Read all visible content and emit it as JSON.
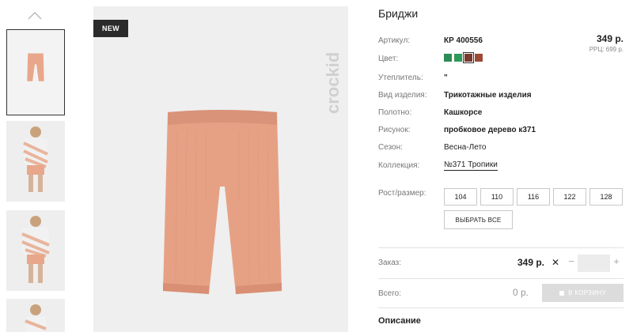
{
  "gallery": {
    "up_icon": "chevron-up-icon",
    "badge": "NEW",
    "brand_logo": "crockid"
  },
  "product": {
    "title": "Бриджи",
    "price": "349 р.",
    "rrp": "РРЦ: 699 р.",
    "rows": [
      {
        "label": "Артикул:",
        "value": "КР 400556"
      },
      {
        "label": "Цвет:",
        "value": ""
      },
      {
        "label": "Утеплитель:",
        "value": "\""
      },
      {
        "label": "Вид изделия:",
        "value": "Трикотажные изделия"
      },
      {
        "label": "Полотно:",
        "value": "Кашкорсе"
      },
      {
        "label": "Рисунок:",
        "value": "пробковое дерево к371"
      },
      {
        "label": "Сезон:",
        "value": "Весна-Лето"
      },
      {
        "label": "Коллекция:",
        "value": "№371 Тропики"
      }
    ],
    "colors": [
      "#2e8b57",
      "#2e9a5a",
      "#7a3b2e",
      "#9c4a35"
    ],
    "selected_color_index": 2
  },
  "sizes": {
    "label": "Рост/размер:",
    "options": [
      "104",
      "110",
      "116",
      "122",
      "128"
    ],
    "select_all": "ВЫБРАТЬ ВСЕ"
  },
  "order": {
    "label": "Заказ:",
    "price": "349 р.",
    "times": "✕",
    "minus": "−",
    "plus": "+",
    "quantity": ""
  },
  "total": {
    "label": "Всего:",
    "value": "0 р.",
    "cart_button": "В КОРЗИНУ"
  },
  "description": {
    "title": "Описание"
  }
}
